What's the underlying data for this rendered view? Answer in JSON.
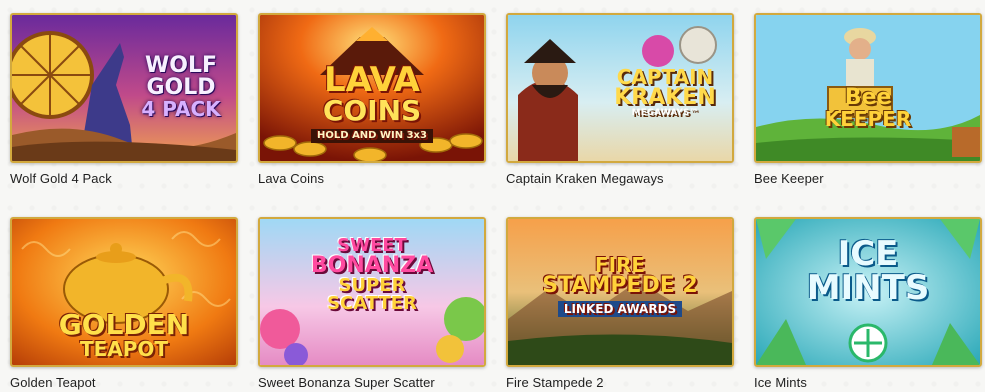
{
  "games": [
    {
      "title": "Wolf Gold 4 Pack",
      "logo_lines": [
        "WOLF",
        "GOLD",
        "4 PACK"
      ],
      "accent": "#7b3fb3"
    },
    {
      "title": "Lava Coins",
      "logo_lines": [
        "LAVA",
        "COINS",
        "HOLD AND WIN 3x3"
      ],
      "accent": "#e34b12"
    },
    {
      "title": "Captain Kraken Megaways",
      "logo_lines": [
        "CAPTAIN",
        "KRAKEN",
        "MEGAWAYS™"
      ],
      "accent": "#2e8fb8"
    },
    {
      "title": "Bee Keeper",
      "logo_lines": [
        "Bee",
        "KEEPER"
      ],
      "accent": "#6bbf3a"
    },
    {
      "title": "Golden Teapot",
      "logo_lines": [
        "GOLDEN",
        "TEAPOT"
      ],
      "accent": "#f08a12"
    },
    {
      "title": "Sweet Bonanza Super Scatter",
      "logo_lines": [
        "SWEET",
        "BONANZA",
        "SUPER",
        "SCATTER"
      ],
      "accent": "#ef6fb0"
    },
    {
      "title": "Fire Stampede 2",
      "logo_lines": [
        "FIRE",
        "STAMPEDE 2",
        "LINKED AWARDS"
      ],
      "accent": "#d8491b"
    },
    {
      "title": "Ice Mints",
      "logo_lines": [
        "ICE",
        "MINTS"
      ],
      "accent": "#2cb8c8"
    }
  ],
  "colors": {
    "card_border": "#d2a93e",
    "title_text": "#1f1f1f"
  }
}
